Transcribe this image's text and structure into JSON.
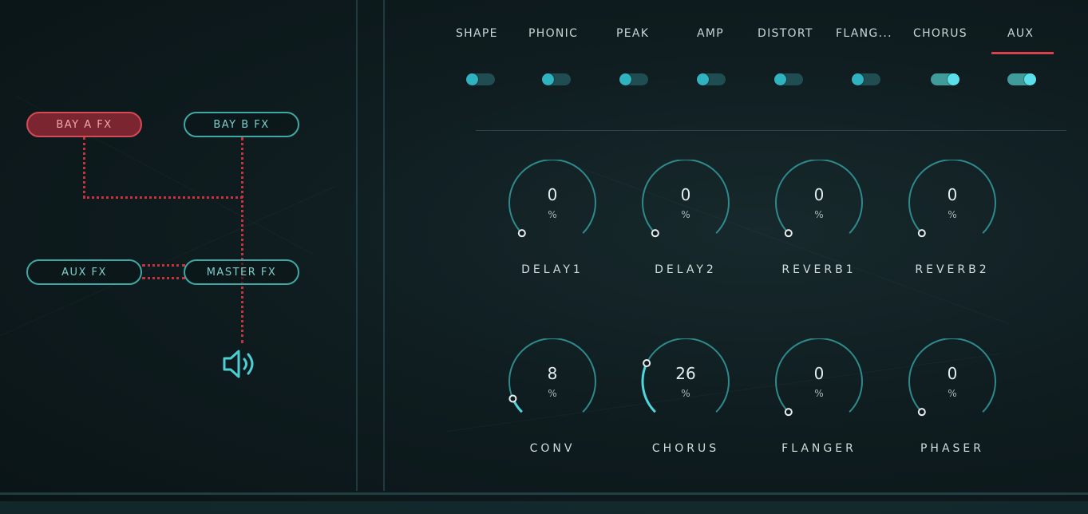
{
  "routing": {
    "bay_a": "BAY A FX",
    "bay_b": "BAY B FX",
    "aux": "AUX FX",
    "master": "MASTER FX",
    "active": "bay_a",
    "speaker_icon": "speaker-icon"
  },
  "tabs": [
    {
      "label": "SHAPE",
      "enabled": false
    },
    {
      "label": "PHONIC",
      "enabled": false
    },
    {
      "label": "PEAK",
      "enabled": false
    },
    {
      "label": "AMP",
      "enabled": false
    },
    {
      "label": "DISTORT",
      "enabled": false
    },
    {
      "label": "FLANG...",
      "enabled": false
    },
    {
      "label": "CHORUS",
      "enabled": true
    },
    {
      "label": "AUX",
      "enabled": true
    }
  ],
  "selected_tab": "AUX",
  "knobs": [
    {
      "label": "DELAY1",
      "value": "0",
      "unit": "%",
      "level": 0
    },
    {
      "label": "DELAY2",
      "value": "0",
      "unit": "%",
      "level": 0
    },
    {
      "label": "REVERB1",
      "value": "0",
      "unit": "%",
      "level": 0
    },
    {
      "label": "REVERB2",
      "value": "0",
      "unit": "%",
      "level": 0
    },
    {
      "label": "CONV",
      "value": "8",
      "unit": "%",
      "level": 0.08
    },
    {
      "label": "CHORUS",
      "value": "26",
      "unit": "%",
      "level": 0.26
    },
    {
      "label": "FLANGER",
      "value": "0",
      "unit": "%",
      "level": 0
    },
    {
      "label": "PHASER",
      "value": "0",
      "unit": "%",
      "level": 0
    }
  ],
  "colors": {
    "accent": "#3fa8a4",
    "active_route": "#c8323e",
    "tab_underline": "#d9414c",
    "knob_arc": "#2e8a8c",
    "knob_fill": "#4fd6dc"
  }
}
